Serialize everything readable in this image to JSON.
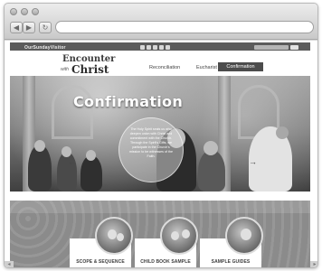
{
  "browser": {
    "back_glyph": "◀",
    "forward_glyph": "▶",
    "reload_glyph": "↻",
    "address_value": ""
  },
  "site": {
    "topbar_brand": "OurSundayVisitor",
    "logo": {
      "line1": "Encounter",
      "with": "with",
      "line2": "Christ"
    },
    "nav": {
      "items": [
        "Reconciliation",
        "Eucharist"
      ],
      "active": "Confirmation"
    },
    "hero": {
      "title": "Confirmation",
      "body": "The Holy Spirit seals us who deepen union with Christ and commitment with the Church. Through the Spirit's Gifts, we participate in the Church's mission to be witnesses of the Faith.",
      "prev_arrow": "←",
      "next_arrow": "→"
    },
    "cards": [
      {
        "label": "SCOPE & SEQUENCE"
      },
      {
        "label": "CHILD BOOK SAMPLE"
      },
      {
        "label": "SAMPLE GUIDES"
      }
    ]
  },
  "icons": {
    "social": [
      "facebook-icon",
      "pinterest-icon",
      "youtube-icon",
      "twitter-icon",
      "rss-icon"
    ],
    "search": "search-icon"
  },
  "colors": {
    "top_strip": "#5b5b5b",
    "active_nav": "#4c4c4c",
    "band": "#8b8b8b"
  }
}
